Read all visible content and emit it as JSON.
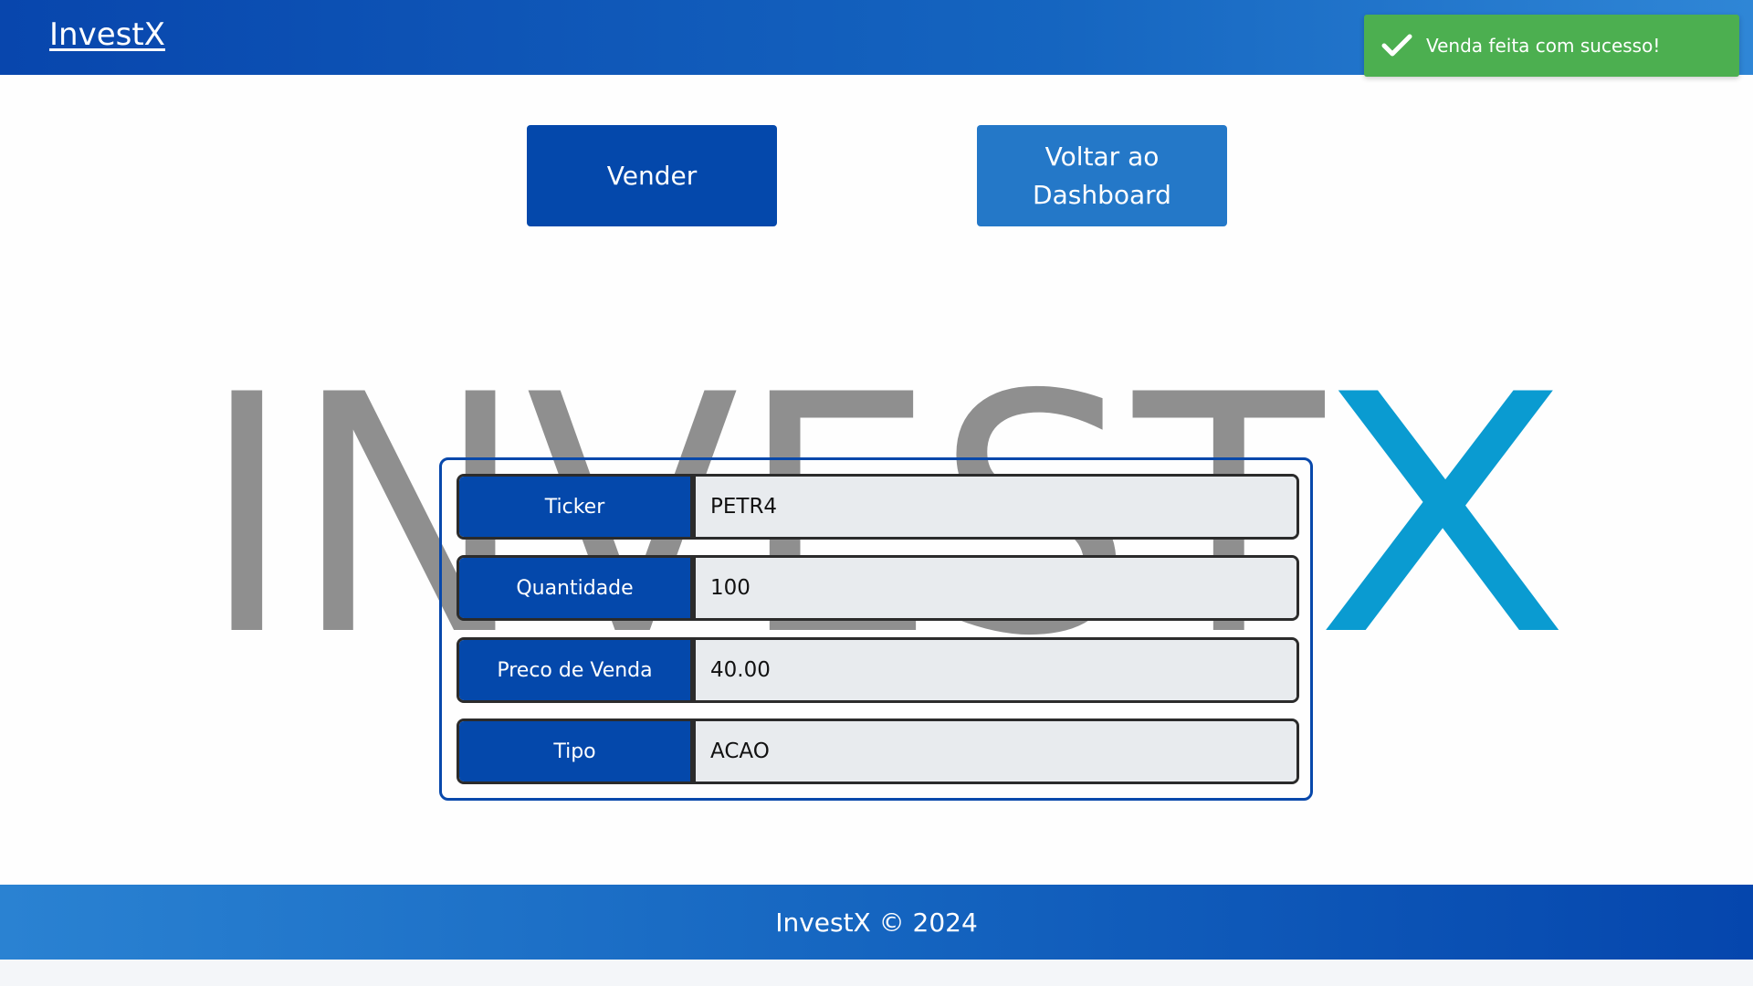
{
  "navbar": {
    "brand": "InvestX"
  },
  "toast": {
    "message": "Venda feita com sucesso!",
    "icon": "check-icon",
    "color": "#4caf50"
  },
  "actions": {
    "sell_label": "Vender",
    "back_label": "Voltar ao Dashboard"
  },
  "watermark": {
    "text_main": "INVEST",
    "text_accent": "X",
    "color_main": "#8a8a8a",
    "color_accent": "#0a9bd1"
  },
  "form": {
    "rows": [
      {
        "label": "Ticker",
        "value": "PETR4"
      },
      {
        "label": "Quantidade",
        "value": "100"
      },
      {
        "label": "Preco de Venda",
        "value": "40.00"
      },
      {
        "label": "Tipo",
        "value": "ACAO"
      }
    ]
  },
  "footer": {
    "text": "InvestX © 2024"
  },
  "colors": {
    "primary": "#0448ab",
    "secondary": "#2478c8",
    "success": "#4caf50"
  }
}
